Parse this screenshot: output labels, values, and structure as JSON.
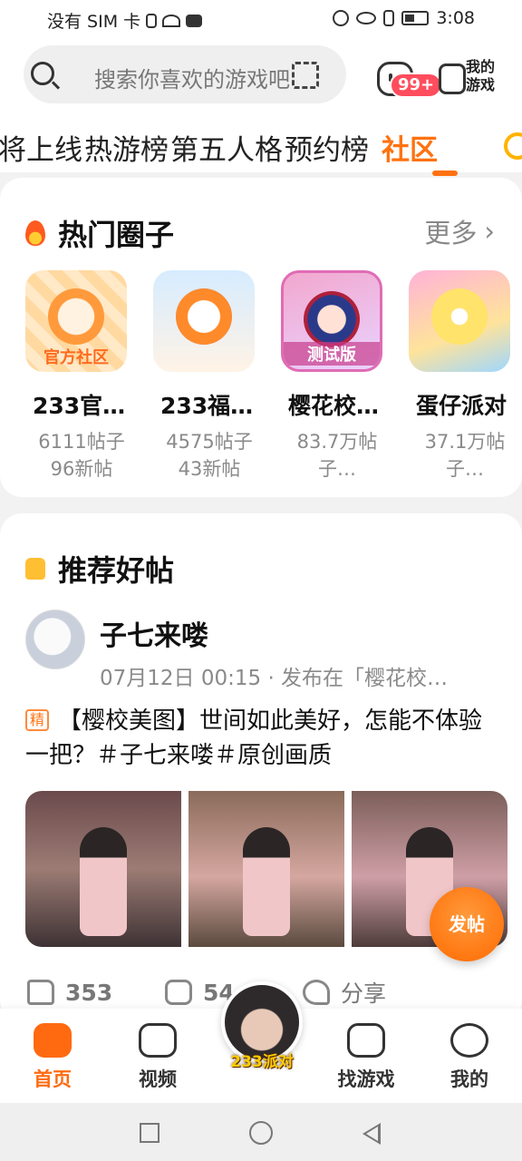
{
  "status_bar": {
    "carrier": "没有 SIM 卡",
    "time": "3:08"
  },
  "header": {
    "search_placeholder": "搜索你喜欢的游戏吧",
    "message_badge": "99+",
    "my_games_label": "我的游戏",
    "tabs": [
      "将上线",
      "热游榜",
      "第五人格",
      "预约榜",
      "社区"
    ],
    "active_tab": "社区"
  },
  "hot_circles": {
    "title": "热门圈子",
    "more_label": "更多",
    "items": [
      {
        "name": "233官…",
        "thumb_text": "官方社区",
        "stat1": "6111帖子",
        "stat2": "96新帖"
      },
      {
        "name": "233福…",
        "thumb_text": "",
        "stat1": "4575帖子",
        "stat2": "43新帖"
      },
      {
        "name": "樱花校…",
        "thumb_text": "测试版",
        "stat1": "83.7万帖",
        "stat2": "子…"
      },
      {
        "name": "蛋仔派对",
        "thumb_text": "",
        "stat1": "37.1万帖",
        "stat2": "子…"
      }
    ]
  },
  "recommended": {
    "title": "推荐好帖",
    "post": {
      "author": "子七来喽",
      "meta": "07月12日 00:15 · 发布在「樱花校…",
      "tag": "精",
      "text": "【樱校美图】世间如此美好，怎能不体验一把？＃子七来喽＃原创画质",
      "likes": "353",
      "comments": "54",
      "share_label": "分享"
    }
  },
  "fab_label": "发帖",
  "bottom_nav": {
    "home": "首页",
    "video": "视频",
    "center": "233派对",
    "find_games": "找游戏",
    "mine": "我的"
  },
  "colors": {
    "accent": "#ff7210",
    "badge": "#ff4d5d"
  }
}
